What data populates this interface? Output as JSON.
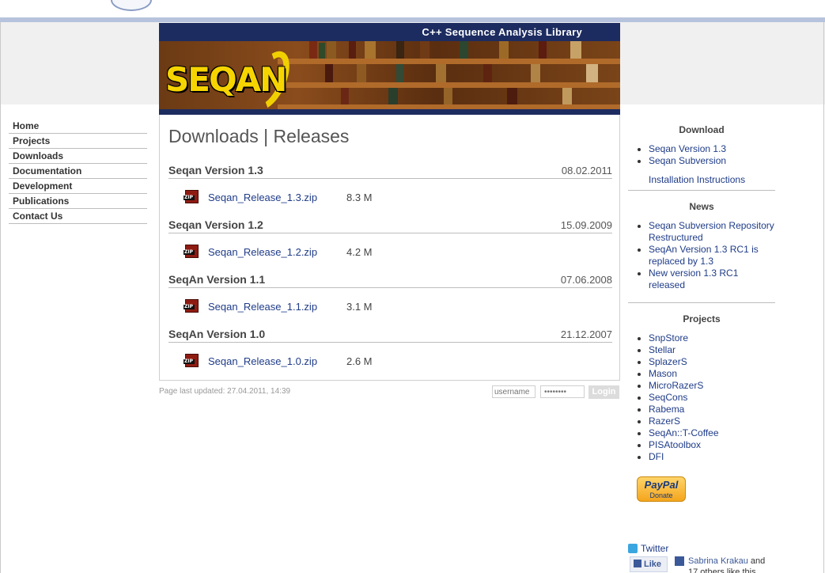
{
  "banner": {
    "subtitle": "C++ Sequence Analysis Library",
    "logo_text": "SEQAN"
  },
  "nav": {
    "items": [
      "Home",
      "Projects",
      "Downloads",
      "Documentation",
      "Development",
      "Publications",
      "Contact Us"
    ]
  },
  "main": {
    "title": "Downloads | Releases",
    "releases": [
      {
        "name": "Seqan Version 1.3",
        "date": "08.02.2011",
        "file": "Seqan_Release_1.3.zip",
        "size": "8.3 M"
      },
      {
        "name": "Seqan Version 1.2",
        "date": "15.09.2009",
        "file": "Seqan_Release_1.2.zip",
        "size": "4.2 M"
      },
      {
        "name": "SeqAn Version 1.1",
        "date": "07.06.2008",
        "file": "Seqan_Release_1.1.zip",
        "size": "3.1 M"
      },
      {
        "name": "SeqAn Version 1.0",
        "date": "21.12.2007",
        "file": "Seqan_Release_1.0.zip",
        "size": "2.6 M"
      }
    ],
    "zip_icon_label": "ZIP"
  },
  "footer": {
    "last_updated": "Page last updated: 27.04.2011, 14:39",
    "username_placeholder": "username",
    "password_placeholder": "••••••••",
    "login_label": "Login"
  },
  "sidebar": {
    "download": {
      "heading": "Download",
      "items": [
        "Seqan Version 1.3",
        "Seqan Subversion"
      ],
      "install_link": "Installation Instructions"
    },
    "news": {
      "heading": "News",
      "items": [
        "Seqan Subversion Repository Restructured",
        "SeqAn Version 1.3 RC1 is replaced by 1.3",
        "New version 1.3 RC1 released"
      ]
    },
    "projects": {
      "heading": "Projects",
      "items": [
        "SnpStore",
        "Stellar",
        "SplazerS",
        "Mason",
        "MicroRazerS",
        "SeqCons",
        "Rabema",
        "RazerS",
        "SeqAn::T-Coffee",
        "PISAtoolbox",
        "DFI"
      ]
    },
    "paypal": {
      "brand": "PayPal",
      "label": "Donate"
    },
    "twitter_label": "Twitter",
    "facebook": {
      "like_label": "Like",
      "name": "Sabrina Krakau",
      "text_after": " and 17 others like this."
    }
  },
  "colors": {
    "banner_blue": "#1d2c60",
    "link_blue": "#1f3c88",
    "logo_yellow": "#f6d400"
  }
}
